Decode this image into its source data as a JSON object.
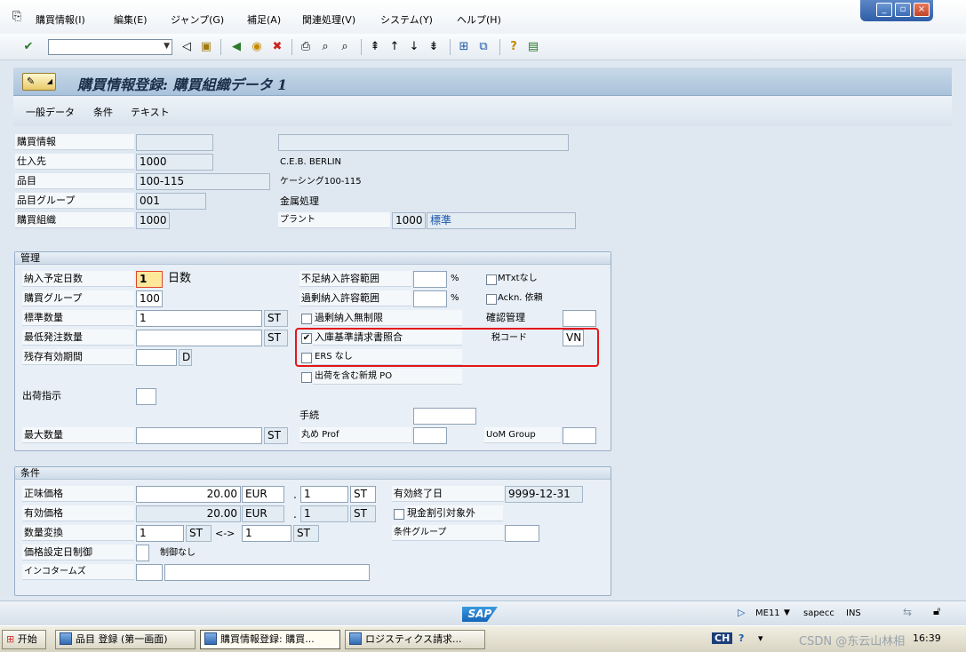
{
  "menu": {
    "items": [
      "購買情報(I)",
      "編集(E)",
      "ジャンプ(G)",
      "補足(A)",
      "関連処理(V)",
      "システム(Y)",
      "ヘルプ(H)"
    ]
  },
  "window_controls": {
    "minimize": "_",
    "restore": "▫",
    "close": "×"
  },
  "toolbar": {
    "command_value": ""
  },
  "title": {
    "text": "購買情報登録: 購買組織データ 1"
  },
  "app_tabs": [
    "一般データ",
    "条件",
    "テキスト"
  ],
  "header": {
    "purchasing_info_label": "購買情報",
    "purchasing_info_value": "",
    "purchasing_info_desc": "",
    "vendor_label": "仕入先",
    "vendor_value": "1000",
    "vendor_name": "C.E.B. BERLIN",
    "material_label": "品目",
    "material_value": "100-115",
    "material_name": "ケーシング100-115",
    "material_group_label": "品目グループ",
    "material_group_value": "001",
    "material_group_name": "金属処理",
    "purch_org_label": "購買組織",
    "purch_org_value": "1000",
    "plant_label": "プラント",
    "plant_value": "1000",
    "plant_name": "標準"
  },
  "control": {
    "group_title": "管理",
    "planned_days_label": "納入予定日数",
    "planned_days_value": "1",
    "planned_days_unit": "日数",
    "purch_group_label": "購買グループ",
    "purch_group_value": "100",
    "std_qty_label": "標準数量",
    "std_qty_value": "1",
    "std_qty_unit": "ST",
    "min_qty_label": "最低発注数量",
    "min_qty_value": "",
    "min_qty_unit": "ST",
    "rem_shelf_label": "残存有効期間",
    "rem_shelf_value": "",
    "rem_shelf_unit": "D",
    "underdel_label": "不足納入許容範囲",
    "underdel_value": "",
    "underdel_unit": "%",
    "overdel_label": "過剰納入許容範囲",
    "overdel_value": "",
    "overdel_unit": "%",
    "unlimited_label": "過剰納入無制限",
    "unlimited_checked": false,
    "gr_iv_label": "入庫基準請求書照合",
    "gr_iv_checked": true,
    "no_ers_label": "ERS なし",
    "no_ers_checked": false,
    "new_po_label": "出荷を含む新規 PO",
    "new_po_checked": false,
    "no_mtext_label": "MTxtなし",
    "no_mtext_checked": false,
    "ackn_label": "Ackn. 依頼",
    "ackn_checked": false,
    "conf_ctrl_label": "確認管理",
    "conf_ctrl_value": "",
    "tax_code_label": "税コード",
    "tax_code_value": "VN",
    "shipping_instr_label": "出荷指示",
    "shipping_instr_value": "",
    "procedure_label": "手続",
    "procedure_value": "",
    "max_qty_label": "最大数量",
    "max_qty_value": "",
    "max_qty_unit": "ST",
    "rounding_label": "丸め Prof",
    "rounding_value": "",
    "uom_group_label": "UoM Group",
    "uom_group_value": ""
  },
  "conditions": {
    "group_title": "条件",
    "net_price_label": "正味価格",
    "net_price_value": "20.00",
    "net_price_currency": "EUR",
    "net_price_per": "1",
    "net_price_unit": "ST",
    "eff_price_label": "有効価格",
    "eff_price_value": "20.00",
    "eff_price_currency": "EUR",
    "eff_price_per": "1",
    "eff_price_unit": "ST",
    "valid_to_label": "有効終了日",
    "valid_to_value": "9999-12-31",
    "no_cash_disc_label": "現金割引対象外",
    "no_cash_disc_checked": false,
    "qty_conv_label": "数量変換",
    "qty_conv_from": "1",
    "qty_conv_from_unit": "ST",
    "qty_conv_arrow": "<->",
    "qty_conv_to": "1",
    "qty_conv_to_unit": "ST",
    "cond_group_label": "条件グループ",
    "cond_group_value": "",
    "pr_date_ctrl_label": "価格設定日制御",
    "pr_date_ctrl_value": "",
    "pr_date_ctrl_text": "制御なし",
    "incoterms_label": "インコタームズ",
    "incoterms_value": "",
    "incoterms_text": ""
  },
  "statusbar": {
    "logo": "SAP",
    "transaction": "ME11",
    "system": "sapecc",
    "mode": "INS"
  },
  "taskbar": {
    "start": "开始",
    "tasks": [
      "品目 登録 (第一画面)",
      "購買情報登録: 購買...",
      "ロジスティクス請求..."
    ],
    "lang": "CH",
    "watermark": "CSDN @东云山林相",
    "clock": "16:39"
  }
}
